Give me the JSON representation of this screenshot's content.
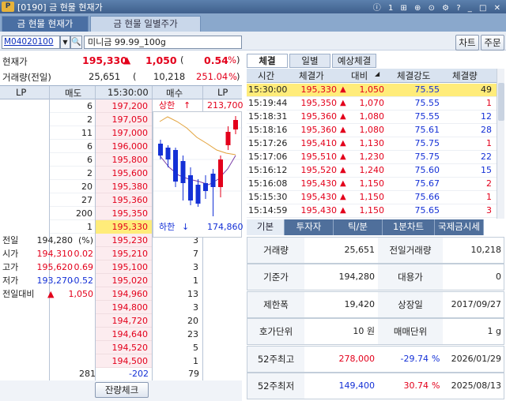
{
  "title": {
    "text": "[0190] 금 현물 현재가",
    "icons": "ⓘ 1 ⊞ ⊕ ⊙ ⚙ ?  _ □ ✕"
  },
  "tabs": [
    {
      "label": "금 현물 현재가"
    },
    {
      "label": "금 현물 일별주가"
    }
  ],
  "search": {
    "code": "M04020100",
    "name": "미니금 99.99_100g"
  },
  "buttons": {
    "chart": "차트",
    "order": "주문",
    "remaining": "잔량체크"
  },
  "quote": {
    "price_label": "현재가",
    "price": "195,330",
    "change_arrow": "▲",
    "change": "1,050",
    "paren_open": "(",
    "pct": "0.54",
    "pct_unit": "%",
    "paren_close": ")",
    "vol_label": "거래량(전일)",
    "vol": "25,651",
    "prev_paren": "(",
    "prev_vol": "10,218",
    "ratio": "251.04",
    "ratio_unit": "%",
    "prev_close": ")"
  },
  "book_header": {
    "lp": "LP",
    "ask": "매도",
    "time": "15:30:00",
    "bid": "매수",
    "lp2": "LP"
  },
  "asks": [
    {
      "qty": "6",
      "price": "197,200"
    },
    {
      "qty": "2",
      "price": "197,050"
    },
    {
      "qty": "11",
      "price": "197,000"
    },
    {
      "qty": "6",
      "price": "196,000"
    },
    {
      "qty": "6",
      "price": "195,800"
    },
    {
      "qty": "2",
      "price": "195,600"
    },
    {
      "qty": "20",
      "price": "195,380"
    },
    {
      "qty": "27",
      "price": "195,360"
    },
    {
      "qty": "200",
      "price": "195,350"
    },
    {
      "qty": "1",
      "price": "195,330"
    }
  ],
  "upper": {
    "label": "상한",
    "arrow": "↑",
    "value": "213,700"
  },
  "lower": {
    "label": "하한",
    "arrow": "↓",
    "value": "174,860"
  },
  "bids": [
    {
      "price": "195,230",
      "qty": "3"
    },
    {
      "price": "195,210",
      "qty": "7"
    },
    {
      "price": "195,100",
      "qty": "3"
    },
    {
      "price": "195,020",
      "qty": "1"
    },
    {
      "price": "194,960",
      "qty": "13"
    },
    {
      "price": "194,800",
      "qty": "3"
    },
    {
      "price": "194,720",
      "qty": "20"
    },
    {
      "price": "194,640",
      "qty": "23"
    },
    {
      "price": "194,520",
      "qty": "5"
    },
    {
      "price": "194,500",
      "qty": "1"
    }
  ],
  "summary": [
    {
      "label": "전일",
      "value": "194,280",
      "extra": "(%)"
    },
    {
      "label": "시가",
      "value": "194,310",
      "extra": "0.02"
    },
    {
      "label": "고가",
      "value": "195,620",
      "extra": "0.69"
    },
    {
      "label": "저가",
      "value": "193,270",
      "extra": "-0.52"
    },
    {
      "label": "전일대비",
      "arrow": "▲",
      "value": "1,050"
    }
  ],
  "totals": {
    "ask_total": "281",
    "diff": "-202",
    "bid_total": "79"
  },
  "right_tabs": [
    {
      "label": "체결"
    },
    {
      "label": "일별"
    },
    {
      "label": "예상체결"
    }
  ],
  "trade_header": {
    "time": "시간",
    "price": "체결가",
    "change": "대비",
    "strength": "체결강도",
    "qty": "체결량"
  },
  "trades": [
    {
      "time": "15:30:00",
      "price": "195,330",
      "change": "1,050",
      "strength": "75.55",
      "qty": "49"
    },
    {
      "time": "15:19:44",
      "price": "195,350",
      "change": "1,070",
      "strength": "75.55",
      "qty": "1"
    },
    {
      "time": "15:18:31",
      "price": "195,360",
      "change": "1,080",
      "strength": "75.55",
      "qty": "12"
    },
    {
      "time": "15:18:16",
      "price": "195,360",
      "change": "1,080",
      "strength": "75.61",
      "qty": "28"
    },
    {
      "time": "15:17:26",
      "price": "195,410",
      "change": "1,130",
      "strength": "75.75",
      "qty": "1"
    },
    {
      "time": "15:17:06",
      "price": "195,510",
      "change": "1,230",
      "strength": "75.75",
      "qty": "22"
    },
    {
      "time": "15:16:12",
      "price": "195,520",
      "change": "1,240",
      "strength": "75.60",
      "qty": "15"
    },
    {
      "time": "15:16:08",
      "price": "195,430",
      "change": "1,150",
      "strength": "75.67",
      "qty": "2"
    },
    {
      "time": "15:15:30",
      "price": "195,430",
      "change": "1,150",
      "strength": "75.66",
      "qty": "1"
    },
    {
      "time": "15:14:59",
      "price": "195,430",
      "change": "1,150",
      "strength": "75.65",
      "qty": "3"
    }
  ],
  "bottom_tabs": [
    {
      "label": "기본"
    },
    {
      "label": "투자자"
    },
    {
      "label": "틱/분"
    },
    {
      "label": "1분차트"
    },
    {
      "label": "국제금시세"
    }
  ],
  "grid": [
    {
      "l1": "거래량",
      "v1": "25,651",
      "l2": "전일거래량",
      "v2": "10,218"
    },
    {
      "l1": "기준가",
      "v1": "194,280",
      "l2": "대용가",
      "v2": "0"
    },
    {
      "l1": "제한폭",
      "v1": "19,420",
      "l2": "상장일",
      "v2": "2017/09/27"
    },
    {
      "l1": "호가단위",
      "v1": "10 원",
      "l2": "매매단위",
      "v2": "1 g"
    },
    {
      "l1": "52주최고",
      "v1": "278,000",
      "pct": "-29.74",
      "unit": "%",
      "date": "2026/01/29"
    },
    {
      "l1": "52주최저",
      "v1": "149,400",
      "pct": "30.74",
      "unit": "%",
      "date": "2025/08/13"
    }
  ],
  "candles": [
    {
      "o": 40,
      "c": 55,
      "h": 35,
      "l": 60,
      "up": false
    },
    {
      "o": 45,
      "c": 60,
      "h": 42,
      "l": 70,
      "up": false
    },
    {
      "o": 48,
      "c": 88,
      "h": 45,
      "l": 95,
      "up": false
    },
    {
      "o": 62,
      "c": 90,
      "h": 55,
      "l": 112,
      "up": false
    },
    {
      "o": 80,
      "c": 112,
      "h": 70,
      "l": 118,
      "up": false
    },
    {
      "o": 92,
      "c": 116,
      "h": 85,
      "l": 120,
      "up": false
    },
    {
      "o": 90,
      "c": 100,
      "h": 80,
      "l": 110,
      "up": false
    },
    {
      "o": 78,
      "c": 95,
      "h": 72,
      "l": 132,
      "up": false
    },
    {
      "o": 95,
      "c": 60,
      "h": 55,
      "l": 108,
      "up": true
    },
    {
      "o": 42,
      "c": 25,
      "h": 18,
      "l": 48,
      "up": true
    },
    {
      "o": 22,
      "c": 10,
      "h": 5,
      "l": 28,
      "up": true
    }
  ],
  "colors": {
    "up": "#e3001b",
    "down": "#1430d6",
    "highlight": "#ffec7a"
  }
}
